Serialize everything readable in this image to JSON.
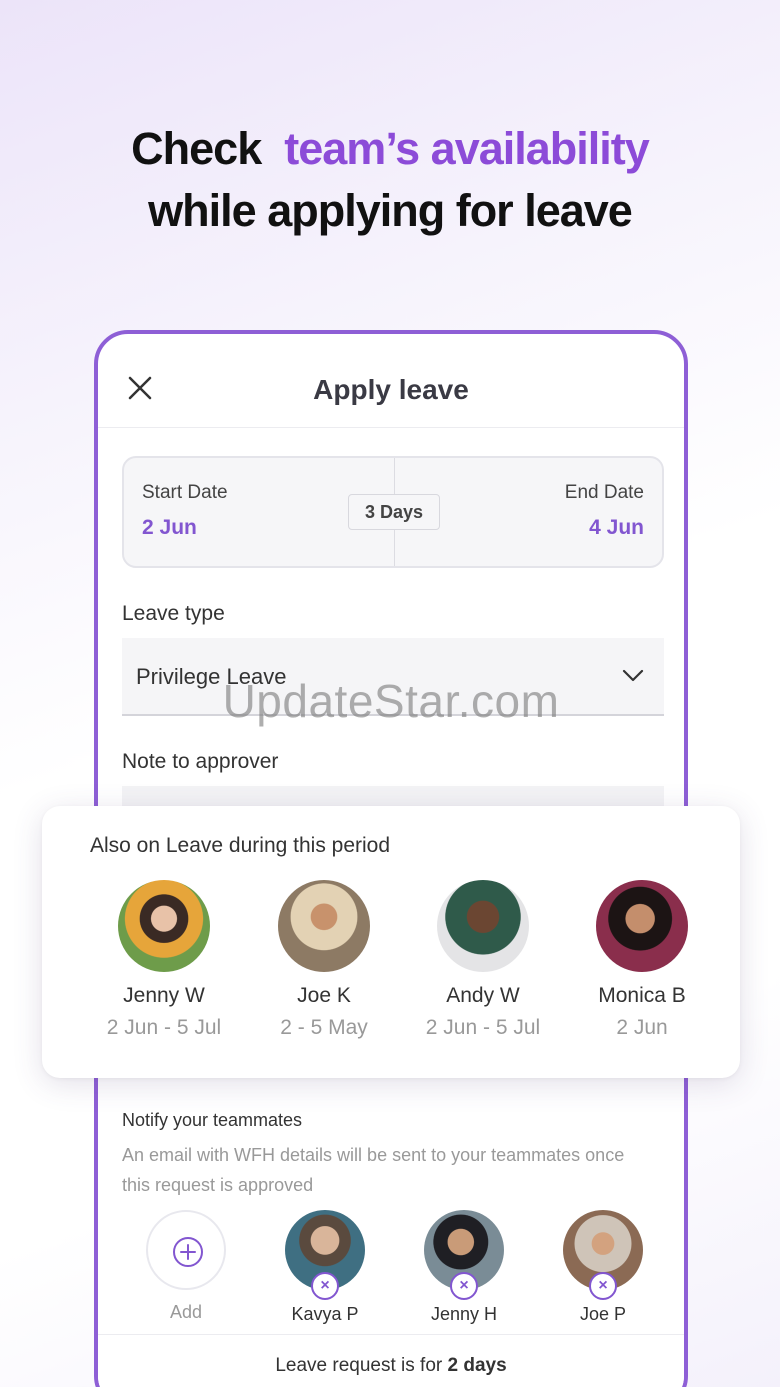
{
  "headline": {
    "line1_prefix": "Check",
    "line1_accent": "team’s availability",
    "line2": "while applying for leave"
  },
  "dialog": {
    "title": "Apply leave",
    "start_label": "Start Date",
    "start_value": "2 Jun",
    "end_label": "End Date",
    "end_value": "4 Jun",
    "duration": "3 Days",
    "leave_type_label": "Leave type",
    "leave_type_value": "Privilege Leave",
    "note_label": "Note to approver"
  },
  "watermark": "UpdateStar.com",
  "on_leave": {
    "title": "Also on Leave during this period",
    "people": [
      {
        "name": "Jenny W",
        "dates": "2 Jun - 5 Jul"
      },
      {
        "name": "Joe K",
        "dates": "2 - 5 May"
      },
      {
        "name": "Andy W",
        "dates": "2 Jun - 5 Jul"
      },
      {
        "name": "Monica B",
        "dates": "2 Jun"
      }
    ]
  },
  "notify": {
    "title": "Notify your teammates",
    "description": "An email with WFH details will be sent to your teammates once this request is approved",
    "add_label": "Add",
    "teammates": [
      {
        "name": "Kavya P"
      },
      {
        "name": "Jenny H"
      },
      {
        "name": "Joe P"
      }
    ]
  },
  "footer": {
    "prefix": "Leave request is for",
    "days": "2 days"
  },
  "colors": {
    "accent": "#8256d0",
    "headline_accent": "#8c4bd8",
    "phone_border": "#8e5fd6"
  }
}
